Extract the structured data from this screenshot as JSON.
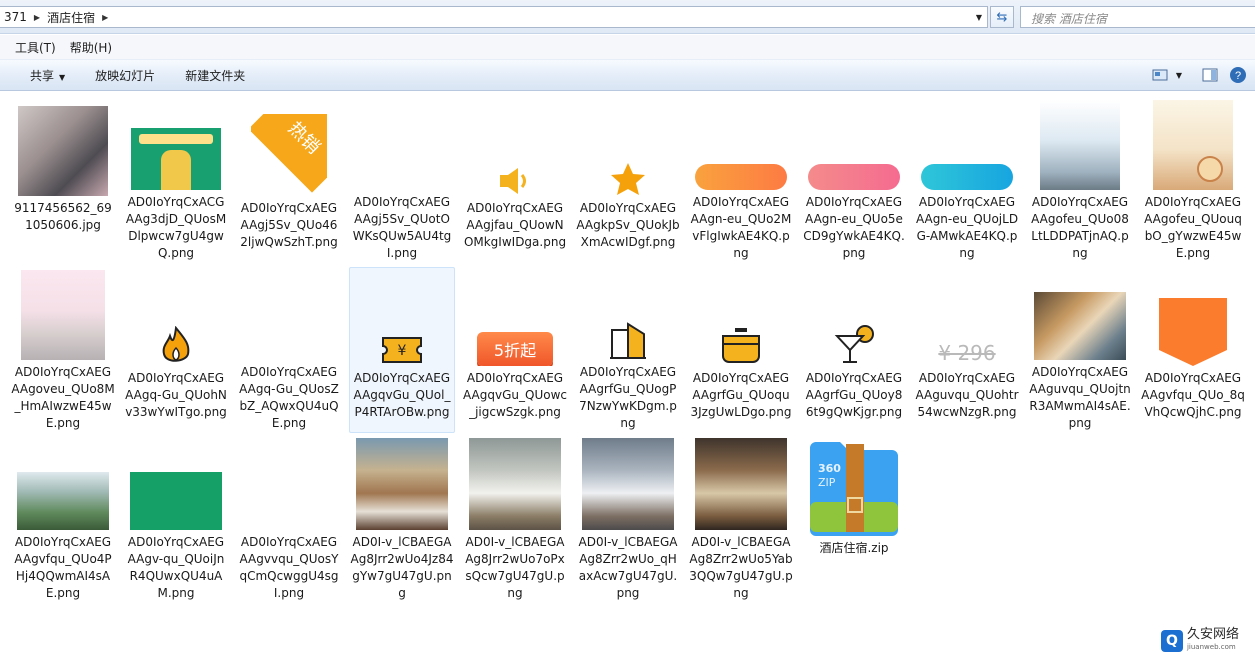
{
  "address": {
    "crumbs": [
      "371",
      "酒店住宿"
    ],
    "search_placeholder": "搜索 酒店住宿"
  },
  "menu": {
    "items": [
      "工具(T)",
      "帮助(H)"
    ]
  },
  "toolbar": {
    "share_label": "共享",
    "slideshow_label": "放映幻灯片",
    "new_folder_label": "新建文件夹",
    "icons": [
      "view-menu-icon",
      "preview-pane-icon",
      "help-icon"
    ]
  },
  "files": [
    {
      "name": "9117456562_691050606.jpg",
      "kind": "photo-legs"
    },
    {
      "name": "AD0IoYrqCxACGAAg3djD_QUosMDlpwcw7gU4gwQ.png",
      "kind": "banner-green"
    },
    {
      "name": "AD0IoYrqCxAEGAAgj5Sv_QUo462ljwQwSzhT.png",
      "kind": "hot-corner"
    },
    {
      "name": "AD0IoYrqCxAEGAAgj5Sv_QUotOWKsQUw5AU4tgI.png",
      "kind": "white-strip"
    },
    {
      "name": "AD0IoYrqCxAEGAAgjfau_QUowNOMkgIwIDga.png",
      "kind": "speaker"
    },
    {
      "name": "AD0IoYrqCxAEGAAgkpSv_QUokJbXmAcwIDgf.png",
      "kind": "star"
    },
    {
      "name": "AD0IoYrqCxAEGAAgn-eu_QUo2MvFlgIwkAE4KQ.png",
      "kind": "pill-orange"
    },
    {
      "name": "AD0IoYrqCxAEGAAgn-eu_QUo5eCD9gYwkAE4KQ.png",
      "kind": "pill-pink"
    },
    {
      "name": "AD0IoYrqCxAEGAAgn-eu_QUojLDG-AMwkAE4KQ.png",
      "kind": "pill-teal"
    },
    {
      "name": "AD0IoYrqCxAEGAAgofeu_QUo08LtLDDPATjnAQ.png",
      "kind": "photo-window"
    },
    {
      "name": "AD0IoYrqCxAEGAAgofeu_QUouqbO_gYwzwE45wE.png",
      "kind": "photo-clock"
    },
    {
      "name": "AD0IoYrqCxAEGAAgoveu_QUo8M_HmAIwzwE45wE.png",
      "kind": "photo-bed-pink"
    },
    {
      "name": "AD0IoYrqCxAEGAAgq-Gu_QUohNv33wYwITgo.png",
      "kind": "flame"
    },
    {
      "name": "AD0IoYrqCxAEGAAgq-Gu_QUosZbZ_AQwxQU4uQE.png",
      "kind": "white-strip2"
    },
    {
      "name": "AD0IoYrqCxAEGAAgqvGu_QUol_P4RTArOBw.png",
      "kind": "ticket"
    },
    {
      "name": "AD0IoYrqCxAEGAAgqvGu_QUowc_jigcwSzgk.png",
      "kind": "discount",
      "label": "5折起"
    },
    {
      "name": "AD0IoYrqCxAEGAAgrfGu_QUogP7NzwYwKDgm.png",
      "kind": "building"
    },
    {
      "name": "AD0IoYrqCxAEGAAgrfGu_QUoqu3JzgUwLDgo.png",
      "kind": "pot"
    },
    {
      "name": "AD0IoYrqCxAEGAAgrfGu_QUoy86t9gQwKjgr.png",
      "kind": "cocktail"
    },
    {
      "name": "AD0IoYrqCxAEGAAguvqu_QUohtr54wcwNzgR.png",
      "kind": "price",
      "label": "¥ 296"
    },
    {
      "name": "AD0IoYrqCxAEGAAguvqu_QUojtnR3AMwmAI4sAE.png",
      "kind": "photo-patio"
    },
    {
      "name": "AD0IoYrqCxAEGAAgvfqu_QUo_8qVhQcwQjhC.png",
      "kind": "orange-tag"
    },
    {
      "name": "AD0IoYrqCxAEGAAgvfqu_QUo4PHj4QQwmAI4sAE.png",
      "kind": "photo-house"
    },
    {
      "name": "AD0IoYrqCxAEGAAgv-qu_QUoiJnR4QUwxQU4uAM.png",
      "kind": "green-rect"
    },
    {
      "name": "AD0IoYrqCxAEGAAgvvqu_QUosYqCmQcwggU4sgI.png",
      "kind": "white-strip3"
    },
    {
      "name": "AD0I-v_lCBAEGAAg8Jrr2wUo4Jz84gYw7gU47gU.png",
      "kind": "photo-room1"
    },
    {
      "name": "AD0I-v_lCBAEGAAg8Jrr2wUo7oPxsQcw7gU47gU.png",
      "kind": "photo-room2"
    },
    {
      "name": "AD0I-v_lCBAEGAAg8Zrr2wUo_qHaxAcw7gU47gU.png",
      "kind": "photo-room3"
    },
    {
      "name": "AD0I-v_lCBAEGAAg8Zrr2wUo5Yab3QQw7gU47gU.png",
      "kind": "photo-room4"
    },
    {
      "name": "酒店住宿.zip",
      "kind": "zip",
      "label": "360 ZIP"
    }
  ],
  "watermark": {
    "title": "久安网络",
    "url": "jiuanweb.com"
  }
}
